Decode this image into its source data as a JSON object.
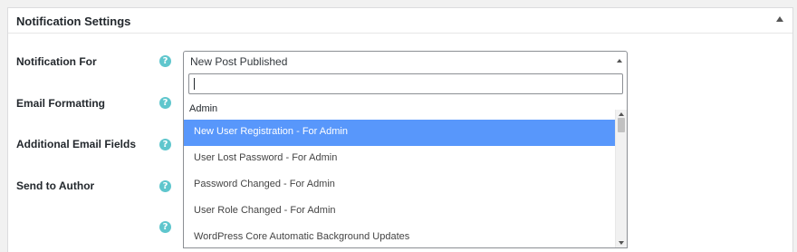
{
  "panel": {
    "title": "Notification Settings"
  },
  "rows": {
    "notification_for": "Notification For",
    "email_formatting": "Email Formatting",
    "additional_email_fields": "Additional Email Fields",
    "send_to_author": "Send to Author"
  },
  "help": {
    "glyph": "?"
  },
  "select": {
    "value": "New Post Published",
    "search_value": ""
  },
  "dropdown": {
    "group_label": "Admin",
    "options": [
      "New User Registration - For Admin",
      "User Lost Password - For Admin",
      "Password Changed - For Admin",
      "User Role Changed - For Admin",
      "WordPress Core Automatic Background Updates"
    ],
    "selected_index": 0
  },
  "colors": {
    "highlight": "#5897fb",
    "help_icon": "#5fc6cd",
    "panel_bg": "#ffffff",
    "page_bg": "#f1f1f1"
  }
}
